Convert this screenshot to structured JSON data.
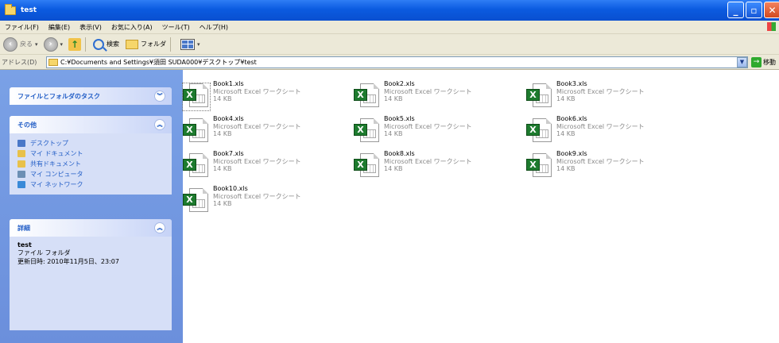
{
  "window": {
    "title": "test"
  },
  "menu": [
    "ファイル(F)",
    "編集(E)",
    "表示(V)",
    "お気に入り(A)",
    "ツール(T)",
    "ヘルプ(H)"
  ],
  "toolbar": {
    "back": "戻る",
    "search": "検索",
    "folders": "フォルダ"
  },
  "address": {
    "label": "アドレス(D)",
    "path": "C:¥Documents and Settings¥須田 SUDA000¥デスクトップ¥test",
    "go": "移動"
  },
  "tasks": {
    "file_tasks_title": "ファイルとフォルダのタスク",
    "other_title": "その他",
    "other_places": [
      {
        "label": "デスクトップ",
        "color": "#4a78c8"
      },
      {
        "label": "マイ ドキュメント",
        "color": "#e8c14a"
      },
      {
        "label": "共有ドキュメント",
        "color": "#e8c14a"
      },
      {
        "label": "マイ コンピュータ",
        "color": "#6c8fb4"
      },
      {
        "label": "マイ ネットワーク",
        "color": "#3a8ad8"
      }
    ],
    "details_title": "詳細",
    "details": {
      "name": "test",
      "type": "ファイル フォルダ",
      "modified": "更新日時: 2010年11月5日、23:07"
    }
  },
  "files": [
    {
      "name": "Book1.xls",
      "type": "Microsoft Excel ワークシート",
      "size": "14 KB",
      "selected": true
    },
    {
      "name": "Book2.xls",
      "type": "Microsoft Excel ワークシート",
      "size": "14 KB"
    },
    {
      "name": "Book3.xls",
      "type": "Microsoft Excel ワークシート",
      "size": "14 KB"
    },
    {
      "name": "Book4.xls",
      "type": "Microsoft Excel ワークシート",
      "size": "14 KB"
    },
    {
      "name": "Book5.xls",
      "type": "Microsoft Excel ワークシート",
      "size": "14 KB"
    },
    {
      "name": "Book6.xls",
      "type": "Microsoft Excel ワークシート",
      "size": "14 KB"
    },
    {
      "name": "Book7.xls",
      "type": "Microsoft Excel ワークシート",
      "size": "14 KB"
    },
    {
      "name": "Book8.xls",
      "type": "Microsoft Excel ワークシート",
      "size": "14 KB"
    },
    {
      "name": "Book9.xls",
      "type": "Microsoft Excel ワークシート",
      "size": "14 KB"
    },
    {
      "name": "Book10.xls",
      "type": "Microsoft Excel ワークシート",
      "size": "14 KB"
    }
  ]
}
